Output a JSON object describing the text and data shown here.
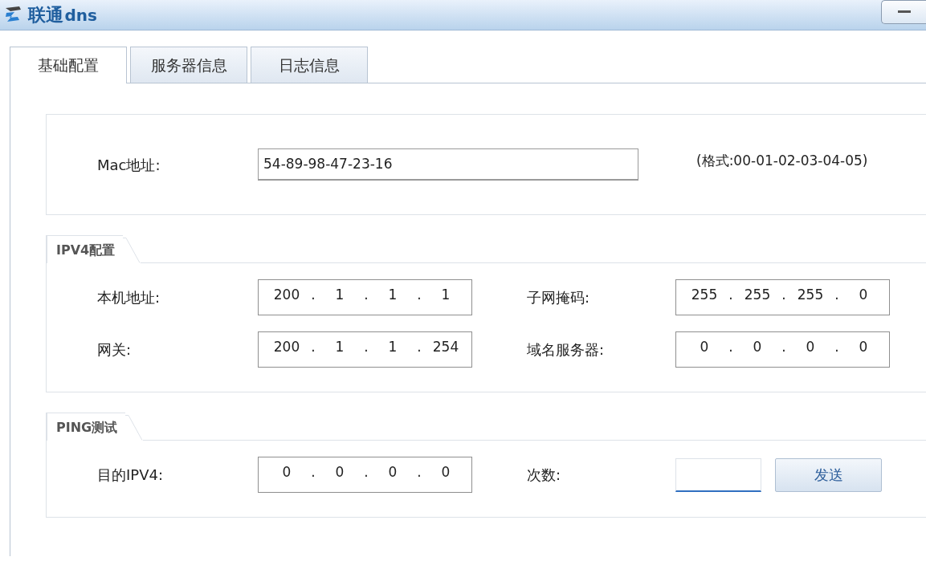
{
  "window": {
    "title": "联通",
    "title_suffix": "dns"
  },
  "tabs": [
    {
      "label": "基础配置",
      "selected": true
    },
    {
      "label": "服务器信息",
      "selected": false
    },
    {
      "label": "日志信息",
      "selected": false
    }
  ],
  "mac": {
    "label": "Mac地址:",
    "value": "54-89-98-47-23-16",
    "hint": "(格式:00-01-02-03-04-05)"
  },
  "sections": [
    {
      "title": "IPV4配置",
      "rows": [
        [
          {
            "kind": "ip",
            "label": "本机地址:",
            "octets": [
              "200",
              "1",
              "1",
              "1"
            ],
            "separator": "."
          },
          {
            "kind": "ip",
            "label": "子网掩码:",
            "octets": [
              "255",
              "255",
              "255",
              "0"
            ],
            "separator": "."
          }
        ],
        [
          {
            "kind": "ip",
            "label": "网关:",
            "octets": [
              "200",
              "1",
              "1",
              "254"
            ],
            "separator": "."
          },
          {
            "kind": "ip",
            "label": "域名服务器:",
            "octets": [
              "0",
              "0",
              "0",
              "0"
            ],
            "separator": "."
          }
        ]
      ]
    },
    {
      "title": "PING测试",
      "rows": [
        [
          {
            "kind": "ip",
            "label": "目的IPV4:",
            "octets": [
              "0",
              "0",
              "0",
              "0"
            ],
            "separator": "."
          },
          {
            "kind": "count",
            "label": "次数:",
            "focused": true,
            "button": "发送"
          }
        ]
      ]
    }
  ]
}
